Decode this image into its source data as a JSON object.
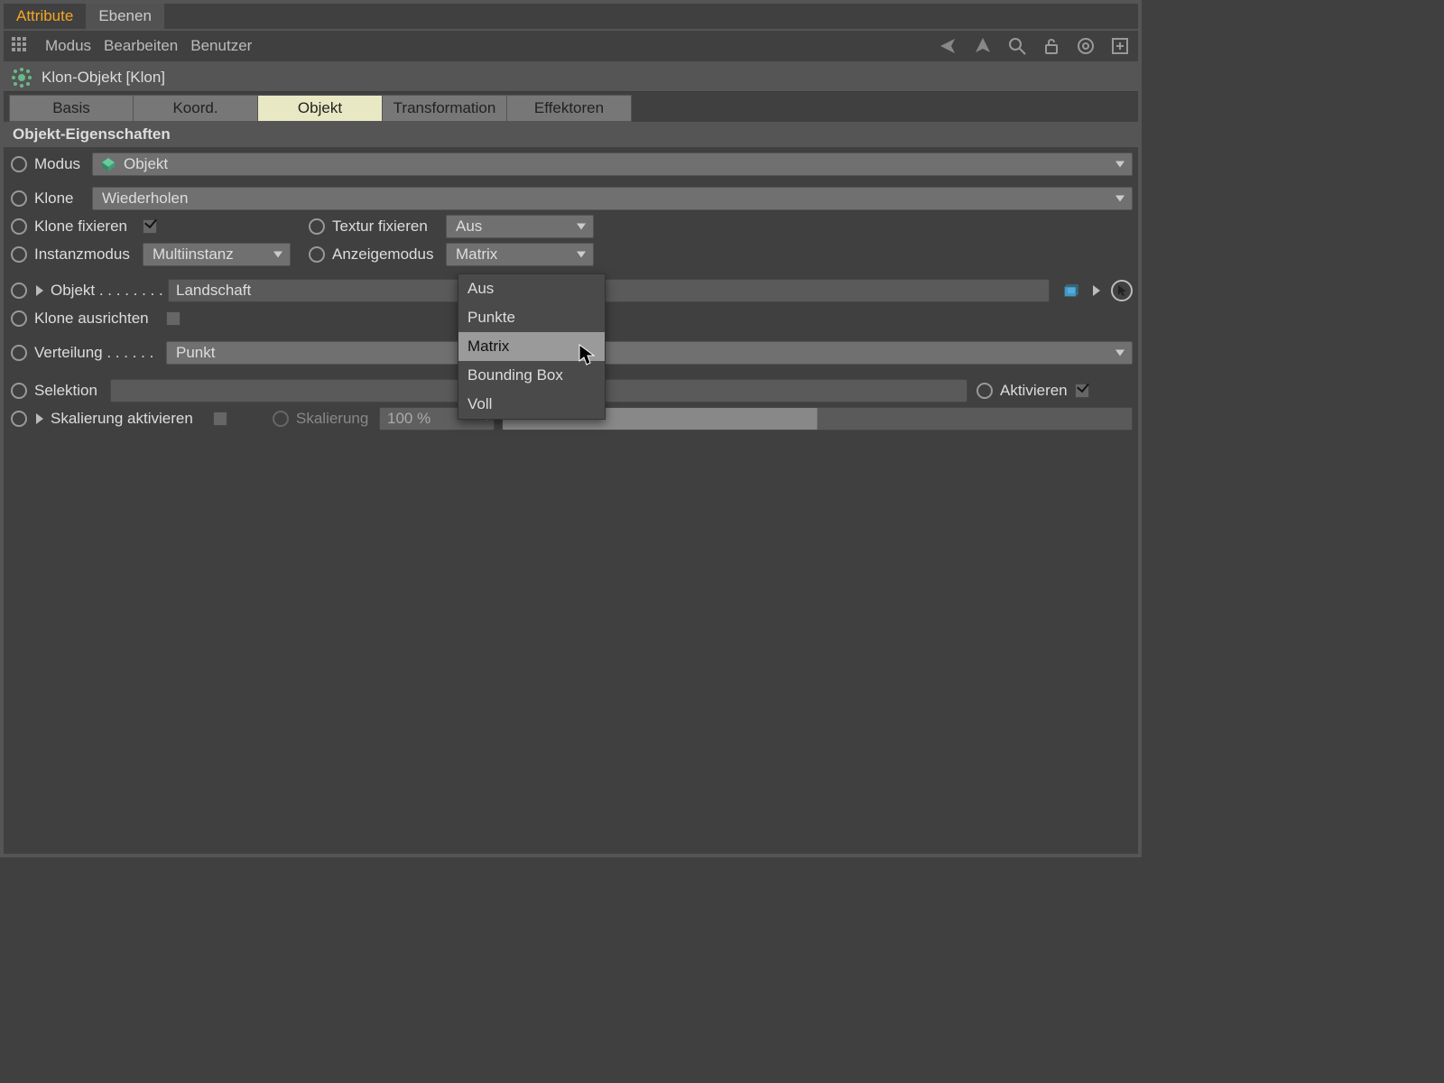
{
  "top_tabs": {
    "active": "Attribute",
    "other": "Ebenen"
  },
  "menu": {
    "modus": "Modus",
    "bearbeiten": "Bearbeiten",
    "benutzer": "Benutzer"
  },
  "header": {
    "title": "Klon-Objekt [Klon]"
  },
  "sub_tabs": {
    "basis": "Basis",
    "koord": "Koord.",
    "objekt": "Objekt",
    "transformation": "Transformation",
    "effektoren": "Effektoren"
  },
  "section": {
    "title": "Objekt-Eigenschaften"
  },
  "props": {
    "modus": {
      "label": "Modus",
      "value": "Objekt"
    },
    "klone": {
      "label": "Klone",
      "value": "Wiederholen"
    },
    "klone_fixieren": {
      "label": "Klone fixieren"
    },
    "textur_fixieren": {
      "label": "Textur fixieren",
      "value": "Aus"
    },
    "instanzmodus": {
      "label": "Instanzmodus",
      "value": "Multiinstanz"
    },
    "anzeigemodus": {
      "label": "Anzeigemodus",
      "value": "Matrix",
      "options": [
        "Aus",
        "Punkte",
        "Matrix",
        "Bounding Box",
        "Voll"
      ],
      "hover": "Matrix"
    },
    "objekt": {
      "label": "Objekt . . . . . . . .",
      "value": "Landschaft"
    },
    "klone_ausrichten": {
      "label": "Klone ausrichten"
    },
    "verteilung": {
      "label": "Verteilung . . . . . .",
      "value": "Punkt"
    },
    "selektion": {
      "label": "Selektion"
    },
    "aktivieren": {
      "label": "Aktivieren"
    },
    "skal_aktiv": {
      "label": "Skalierung aktivieren"
    },
    "skalierung": {
      "label": "Skalierung",
      "value": "100 %"
    }
  }
}
